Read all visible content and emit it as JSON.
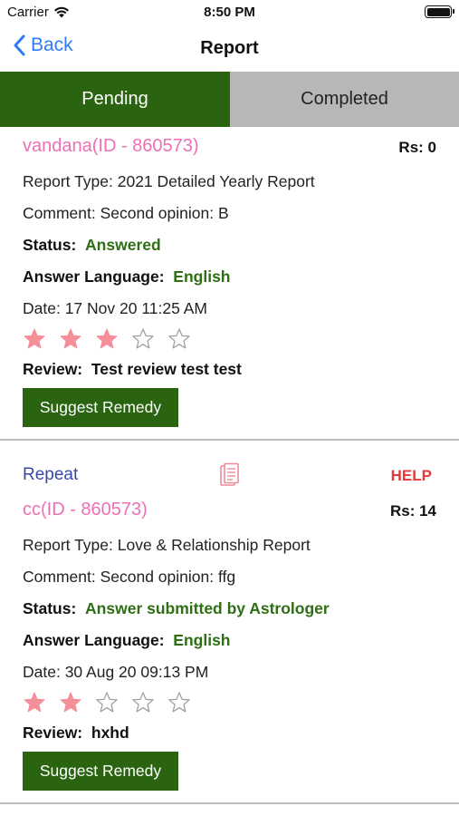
{
  "status_bar": {
    "carrier": "Carrier",
    "time": "8:50 PM"
  },
  "nav": {
    "back_label": "Back",
    "title": "Report"
  },
  "tabs": [
    {
      "label": "Pending",
      "active": true
    },
    {
      "label": "Completed",
      "active": false
    }
  ],
  "colors": {
    "accent_green": "#2a6411",
    "name_pink": "#ee6fb6",
    "link_blue": "#2d7cf6",
    "help_red": "#e23a3a",
    "star_pink": "#f48f9a"
  },
  "reports": [
    {
      "name": "vandana(ID - 860573)",
      "amount": "Rs: 0",
      "report_type": "Report Type: 2021 Detailed Yearly Report",
      "comment": "Comment: Second opinion: B",
      "status_label": "Status:",
      "status_value": "Answered",
      "language_label": "Answer Language:",
      "language_value": "English",
      "date": "Date: 17 Nov 20 11:25 AM",
      "rating": 3,
      "review_label": "Review:",
      "review_value": "Test review test test",
      "button_label": "Suggest Remedy"
    },
    {
      "repeat_label": "Repeat",
      "help_label": "HELP",
      "name": "cc(ID - 860573)",
      "amount": "Rs: 14",
      "report_type": "Report Type: Love & Relationship Report",
      "comment": "Comment: Second opinion: ffg",
      "status_label": "Status:",
      "status_value": "Answer submitted by Astrologer",
      "language_label": "Answer Language:",
      "language_value": "English",
      "date": "Date: 30 Aug 20 09:13 PM",
      "rating": 2,
      "review_label": "Review:",
      "review_value": "hxhd",
      "button_label": "Suggest Remedy"
    }
  ]
}
